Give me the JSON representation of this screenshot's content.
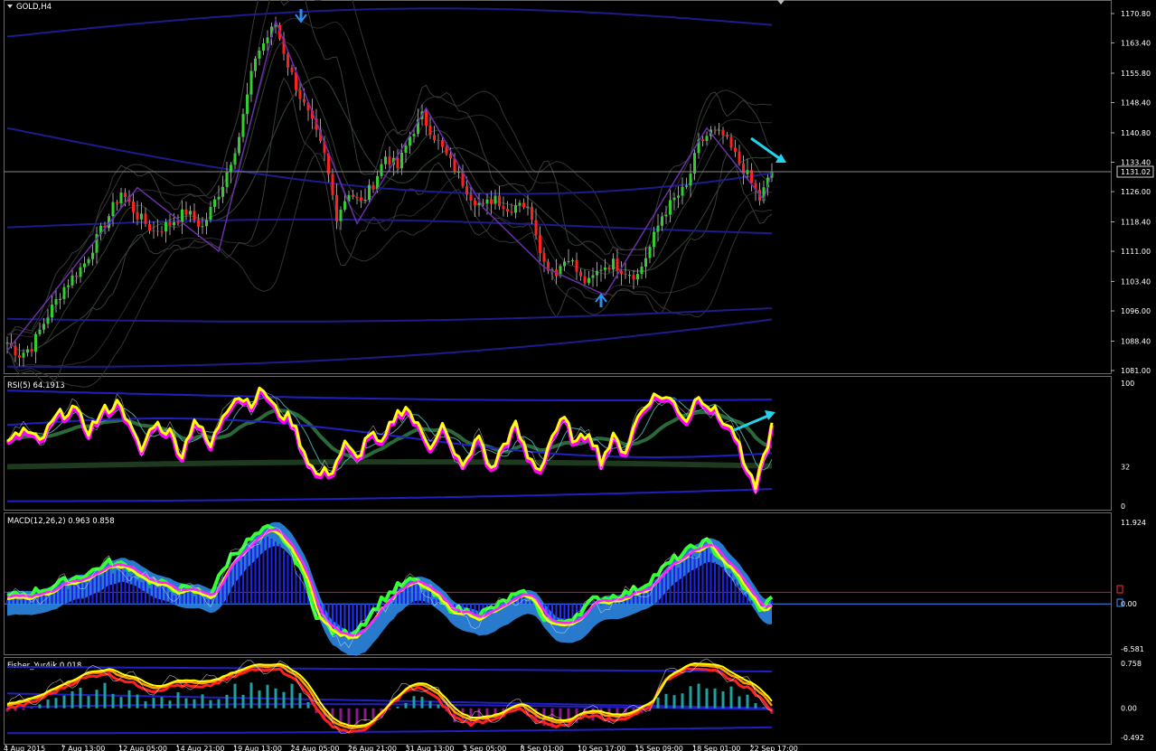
{
  "window": {
    "title": "GOLD,H4",
    "dropdown_icon": "triangle-down-icon"
  },
  "colors": {
    "background": "#000000",
    "bull_candle": "#32cd32",
    "bear_candle": "#ff2020",
    "bands": "#2b2b2b",
    "envelope": "#1c1c8c",
    "rsi_line": "#ffff00",
    "rsi_glow": "#ff00ff",
    "arrow": "#22d3ee",
    "macd_hist": "#1e22e6",
    "macd_cloud": "#2f8ff0",
    "fisher_hist_pos": "#20a0a0",
    "fisher_hist_neg": "#8a1a8a"
  },
  "main": {
    "current_price": "1131.02",
    "price_ticks": [
      "1170.80",
      "1163.40",
      "1155.80",
      "1148.40",
      "1140.80",
      "1133.40",
      "1126.00",
      "1118.40",
      "1111.00",
      "1103.40",
      "1096.00",
      "1088.40",
      "1081.00"
    ],
    "top_arrow_icon": "arrow-down-icon",
    "bottom_arrow_icon": "arrow-up-icon"
  },
  "rsi": {
    "title": "RSI(5) 64.1913",
    "ticks": [
      "100",
      "32",
      "0"
    ]
  },
  "macd": {
    "title": "MACD(12,26,2) 0.963 0.858",
    "ticks": [
      "11.924",
      "0.00",
      "-6.581"
    ]
  },
  "fisher": {
    "title": "Fisher_Yur4ik 0.018",
    "ticks": [
      "0.758",
      "0.00",
      "-0.492"
    ]
  },
  "time_axis": [
    "4 Aug 2015",
    "7 Aug 13:00",
    "12 Aug 05:00",
    "14 Aug 21:00",
    "19 Aug 13:00",
    "24 Aug 05:00",
    "26 Aug 21:00",
    "31 Aug 13:00",
    "3 Sep 05:00",
    "8 Sep 01:00",
    "10 Sep 17:00",
    "15 Sep 09:00",
    "18 Sep 01:00",
    "22 Sep 17:00"
  ],
  "chart_data": {
    "type": "candlestick",
    "symbol": "GOLD",
    "timeframe": "H4",
    "ylim": [
      1081.0,
      1170.8
    ],
    "close_path": [
      [
        0,
        1088
      ],
      [
        3,
        1085
      ],
      [
        6,
        1087
      ],
      [
        10,
        1095
      ],
      [
        14,
        1102
      ],
      [
        19,
        1108
      ],
      [
        24,
        1118
      ],
      [
        28,
        1126
      ],
      [
        32,
        1120
      ],
      [
        36,
        1116
      ],
      [
        40,
        1118
      ],
      [
        44,
        1121
      ],
      [
        48,
        1117
      ],
      [
        53,
        1128
      ],
      [
        57,
        1140
      ],
      [
        61,
        1160
      ],
      [
        64,
        1165
      ],
      [
        66,
        1168
      ],
      [
        69,
        1158
      ],
      [
        72,
        1150
      ],
      [
        75,
        1143
      ],
      [
        78,
        1135
      ],
      [
        81,
        1120
      ],
      [
        84,
        1126
      ],
      [
        87,
        1123
      ],
      [
        90,
        1128
      ],
      [
        93,
        1135
      ],
      [
        96,
        1132
      ],
      [
        99,
        1140
      ],
      [
        102,
        1145
      ],
      [
        105,
        1140
      ],
      [
        108,
        1135
      ],
      [
        111,
        1130
      ],
      [
        114,
        1125
      ],
      [
        117,
        1122
      ],
      [
        120,
        1125
      ],
      [
        123,
        1121
      ],
      [
        126,
        1124
      ],
      [
        129,
        1120
      ],
      [
        132,
        1108
      ],
      [
        135,
        1106
      ],
      [
        138,
        1110
      ],
      [
        141,
        1104
      ],
      [
        143,
        1103
      ],
      [
        146,
        1107
      ],
      [
        149,
        1108
      ],
      [
        152,
        1106
      ],
      [
        155,
        1105
      ],
      [
        158,
        1112
      ],
      [
        161,
        1120
      ],
      [
        164,
        1124
      ],
      [
        167,
        1127
      ],
      [
        170,
        1138
      ],
      [
        173,
        1141
      ],
      [
        176,
        1140
      ],
      [
        179,
        1135
      ],
      [
        182,
        1130
      ],
      [
        185,
        1124
      ],
      [
        188,
        1131
      ]
    ],
    "rsi_path": [
      [
        0,
        50
      ],
      [
        4,
        62
      ],
      [
        8,
        52
      ],
      [
        12,
        72
      ],
      [
        16,
        80
      ],
      [
        20,
        62
      ],
      [
        24,
        78
      ],
      [
        28,
        85
      ],
      [
        30,
        65
      ],
      [
        33,
        45
      ],
      [
        36,
        68
      ],
      [
        40,
        60
      ],
      [
        43,
        42
      ],
      [
        46,
        72
      ],
      [
        50,
        48
      ],
      [
        53,
        75
      ],
      [
        56,
        90
      ],
      [
        60,
        85
      ],
      [
        63,
        95
      ],
      [
        66,
        78
      ],
      [
        70,
        70
      ],
      [
        73,
        45
      ],
      [
        76,
        25
      ],
      [
        80,
        30
      ],
      [
        83,
        50
      ],
      [
        86,
        38
      ],
      [
        89,
        60
      ],
      [
        92,
        48
      ],
      [
        95,
        72
      ],
      [
        98,
        82
      ],
      [
        101,
        64
      ],
      [
        104,
        50
      ],
      [
        107,
        66
      ],
      [
        110,
        40
      ],
      [
        113,
        35
      ],
      [
        116,
        58
      ],
      [
        119,
        28
      ],
      [
        122,
        50
      ],
      [
        125,
        65
      ],
      [
        128,
        40
      ],
      [
        131,
        30
      ],
      [
        134,
        58
      ],
      [
        137,
        70
      ],
      [
        140,
        50
      ],
      [
        143,
        62
      ],
      [
        146,
        38
      ],
      [
        149,
        55
      ],
      [
        152,
        45
      ],
      [
        155,
        72
      ],
      [
        158,
        88
      ],
      [
        161,
        90
      ],
      [
        164,
        84
      ],
      [
        167,
        70
      ],
      [
        170,
        92
      ],
      [
        173,
        80
      ],
      [
        176,
        70
      ],
      [
        179,
        58
      ],
      [
        182,
        24
      ],
      [
        184,
        18
      ],
      [
        186,
        40
      ],
      [
        188,
        64
      ]
    ],
    "macd_path": [
      [
        0,
        0.5
      ],
      [
        5,
        1.0
      ],
      [
        10,
        1.8
      ],
      [
        15,
        3.0
      ],
      [
        20,
        4.0
      ],
      [
        25,
        5.5
      ],
      [
        30,
        5.0
      ],
      [
        35,
        3.0
      ],
      [
        40,
        2.0
      ],
      [
        45,
        1.5
      ],
      [
        50,
        1.0
      ],
      [
        55,
        6.5
      ],
      [
        60,
        9.0
      ],
      [
        64,
        10.5
      ],
      [
        68,
        9.0
      ],
      [
        72,
        5.0
      ],
      [
        76,
        -2.0
      ],
      [
        80,
        -4.5
      ],
      [
        84,
        -5.0
      ],
      [
        88,
        -3.0
      ],
      [
        92,
        0.0
      ],
      [
        96,
        2.0
      ],
      [
        100,
        3.0
      ],
      [
        104,
        1.5
      ],
      [
        108,
        -1.0
      ],
      [
        112,
        -1.5
      ],
      [
        116,
        -2.0
      ],
      [
        120,
        -1.0
      ],
      [
        124,
        0.5
      ],
      [
        128,
        1.0
      ],
      [
        132,
        -2.5
      ],
      [
        136,
        -3.5
      ],
      [
        140,
        -2.0
      ],
      [
        144,
        0.0
      ],
      [
        148,
        0.5
      ],
      [
        152,
        1.0
      ],
      [
        156,
        2.0
      ],
      [
        160,
        4.0
      ],
      [
        164,
        6.0
      ],
      [
        168,
        7.5
      ],
      [
        172,
        8.5
      ],
      [
        176,
        6.0
      ],
      [
        180,
        3.0
      ],
      [
        184,
        -0.5
      ],
      [
        186,
        -1.5
      ],
      [
        188,
        0.96
      ]
    ],
    "fisher_path": [
      [
        0,
        0.05
      ],
      [
        6,
        0.15
      ],
      [
        12,
        0.35
      ],
      [
        18,
        0.55
      ],
      [
        24,
        0.65
      ],
      [
        30,
        0.5
      ],
      [
        36,
        0.35
      ],
      [
        42,
        0.45
      ],
      [
        48,
        0.4
      ],
      [
        54,
        0.55
      ],
      [
        60,
        0.7
      ],
      [
        66,
        0.74
      ],
      [
        70,
        0.6
      ],
      [
        74,
        0.3
      ],
      [
        78,
        -0.15
      ],
      [
        82,
        -0.3
      ],
      [
        86,
        -0.35
      ],
      [
        90,
        -0.2
      ],
      [
        94,
        0.1
      ],
      [
        98,
        0.35
      ],
      [
        102,
        0.4
      ],
      [
        106,
        0.2
      ],
      [
        110,
        -0.1
      ],
      [
        114,
        -0.2
      ],
      [
        118,
        -0.15
      ],
      [
        122,
        -0.05
      ],
      [
        126,
        0.05
      ],
      [
        130,
        -0.15
      ],
      [
        134,
        -0.25
      ],
      [
        138,
        -0.2
      ],
      [
        142,
        -0.05
      ],
      [
        146,
        -0.1
      ],
      [
        150,
        -0.15
      ],
      [
        154,
        -0.05
      ],
      [
        158,
        0.1
      ],
      [
        162,
        0.55
      ],
      [
        166,
        0.7
      ],
      [
        170,
        0.74
      ],
      [
        174,
        0.7
      ],
      [
        178,
        0.55
      ],
      [
        182,
        0.4
      ],
      [
        186,
        0.2
      ],
      [
        188,
        0.02
      ]
    ]
  }
}
